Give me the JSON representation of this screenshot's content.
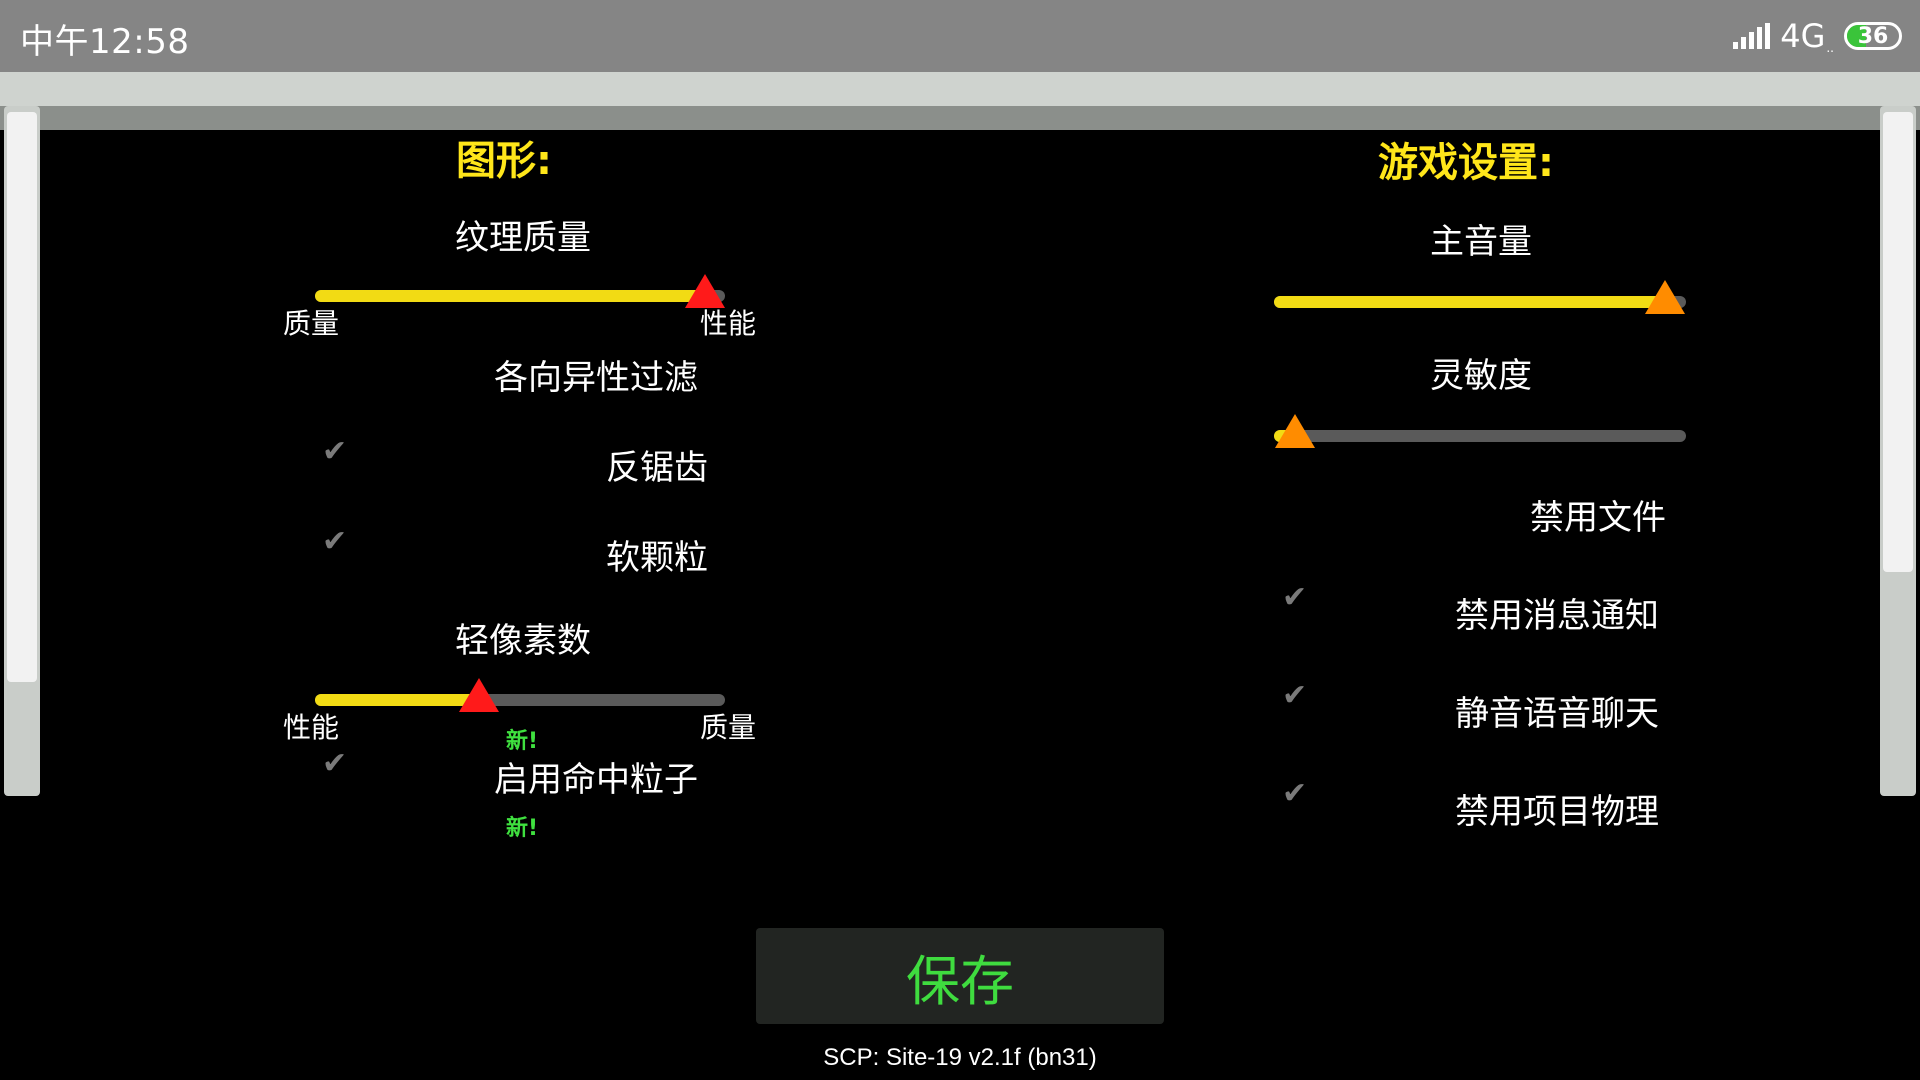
{
  "status_bar": {
    "time": "中午12:58",
    "network": "4G",
    "network_sub": "..",
    "battery": "36",
    "battery_level": 0.36
  },
  "graphics": {
    "heading": "图形:",
    "texture_quality": {
      "label": "纹理质量",
      "left_label": "质量",
      "right_label": "性能",
      "value": 0.95
    },
    "anisotropic_filter": {
      "label": "各向异性过滤"
    },
    "anti_aliasing": {
      "label": "反锯齿",
      "checked": true
    },
    "soft_particles": {
      "label": "软颗粒",
      "checked": true
    },
    "pixel_light_count": {
      "label": "轻像素数",
      "left_label": "性能",
      "right_label": "质量",
      "value": 0.4,
      "new_tag": "新!"
    },
    "hit_particles": {
      "label": "启用命中粒子",
      "checked": true,
      "new_tag": "新!"
    }
  },
  "game_settings": {
    "heading": "游戏设置:",
    "master_volume": {
      "label": "主音量",
      "value": 0.95
    },
    "sensitivity": {
      "label": "灵敏度",
      "value": 0.05
    },
    "disable_files": {
      "label": "禁用文件"
    },
    "disable_notifications": {
      "label": "禁用消息通知",
      "checked": true
    },
    "mute_voice_chat": {
      "label": "静音语音聊天",
      "checked": true
    },
    "disable_item_physics": {
      "label": "禁用项目物理",
      "checked": true
    }
  },
  "check_glyph": "✔",
  "save_button": "保存",
  "version": "SCP: Site-19 v2.1f (bn31)",
  "colors": {
    "heading": "#ffe61a",
    "slider_fill": "#f2db14",
    "slider_track": "#5a5a5a",
    "graphics_handle": "#ff1a1a",
    "game_handle": "#ff8c00",
    "save_text": "#3fdc3f",
    "new_tag": "#3fe03f"
  }
}
